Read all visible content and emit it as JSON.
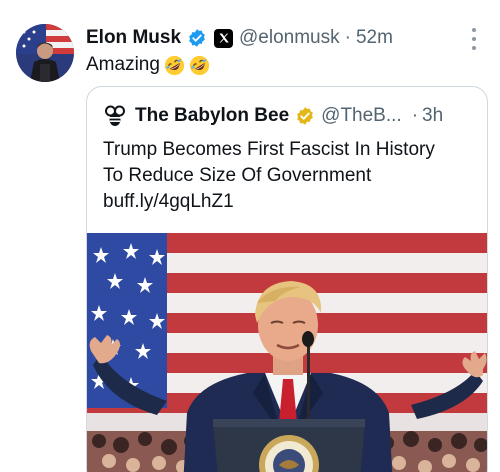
{
  "tweet": {
    "author": {
      "display_name": "Elon Musk",
      "handle": "@elonmusk",
      "verified_icon": "verified-badge-icon",
      "affiliation_icon": "x-logo-icon"
    },
    "separator": "·",
    "time": "52m",
    "text": "Amazing",
    "emojis": [
      "rolling-on-floor-laughing-emoji",
      "rolling-on-floor-laughing-emoji"
    ],
    "more_icon": "more-options-icon"
  },
  "quote": {
    "author": {
      "display_name": "The Babylon Bee",
      "handle": "@TheB...",
      "logo_icon": "babylon-bee-logo-icon",
      "verified_icon": "gold-verified-badge-icon"
    },
    "separator": "·",
    "time": "3h",
    "text": "Trump Becomes First Fascist In History To Reduce Size Of Government",
    "link": "buff.ly/4gqLhZ1",
    "media": {
      "kind": "photo",
      "description_icon": "news-photo-image"
    }
  },
  "colors": {
    "text_primary": "#0f1419",
    "text_secondary": "#536471",
    "verified_blue": "#1d9bf0",
    "verified_gold": "#e2b719",
    "border": "#cfd9de"
  }
}
